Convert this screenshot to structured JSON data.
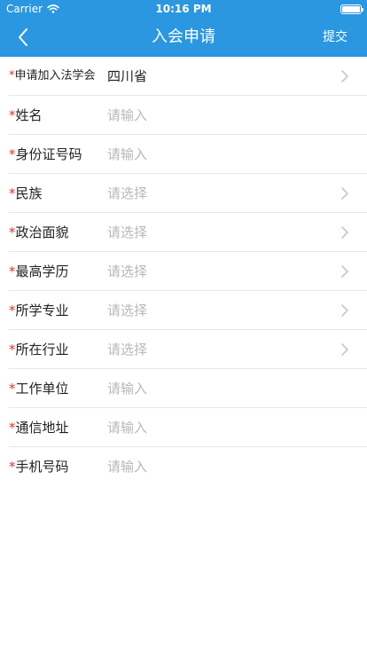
{
  "status_bar": {
    "carrier": "Carrier",
    "time": "10:16 PM"
  },
  "nav": {
    "title": "入会申请",
    "submit_label": "提交"
  },
  "required_mark": "*",
  "fields": [
    {
      "label": "申请加入法学会",
      "value": "四川省",
      "placeholder": "",
      "has_chevron": true
    },
    {
      "label": "姓名",
      "value": "",
      "placeholder": "请输入",
      "has_chevron": false
    },
    {
      "label": "身份证号码",
      "value": "",
      "placeholder": "请输入",
      "has_chevron": false
    },
    {
      "label": "民族",
      "value": "",
      "placeholder": "请选择",
      "has_chevron": true
    },
    {
      "label": "政治面貌",
      "value": "",
      "placeholder": "请选择",
      "has_chevron": true
    },
    {
      "label": "最高学历",
      "value": "",
      "placeholder": "请选择",
      "has_chevron": true
    },
    {
      "label": "所学专业",
      "value": "",
      "placeholder": "请选择",
      "has_chevron": true
    },
    {
      "label": "所在行业",
      "value": "",
      "placeholder": "请选择",
      "has_chevron": true
    },
    {
      "label": "工作单位",
      "value": "",
      "placeholder": "请输入",
      "has_chevron": false
    },
    {
      "label": "通信地址",
      "value": "",
      "placeholder": "请输入",
      "has_chevron": false
    },
    {
      "label": "手机号码",
      "value": "",
      "placeholder": "请输入",
      "has_chevron": false
    }
  ],
  "colors": {
    "accent": "#2a97e0",
    "required": "#e53030",
    "placeholder": "#b8b8b8",
    "chevron": "#c7c7cc"
  }
}
